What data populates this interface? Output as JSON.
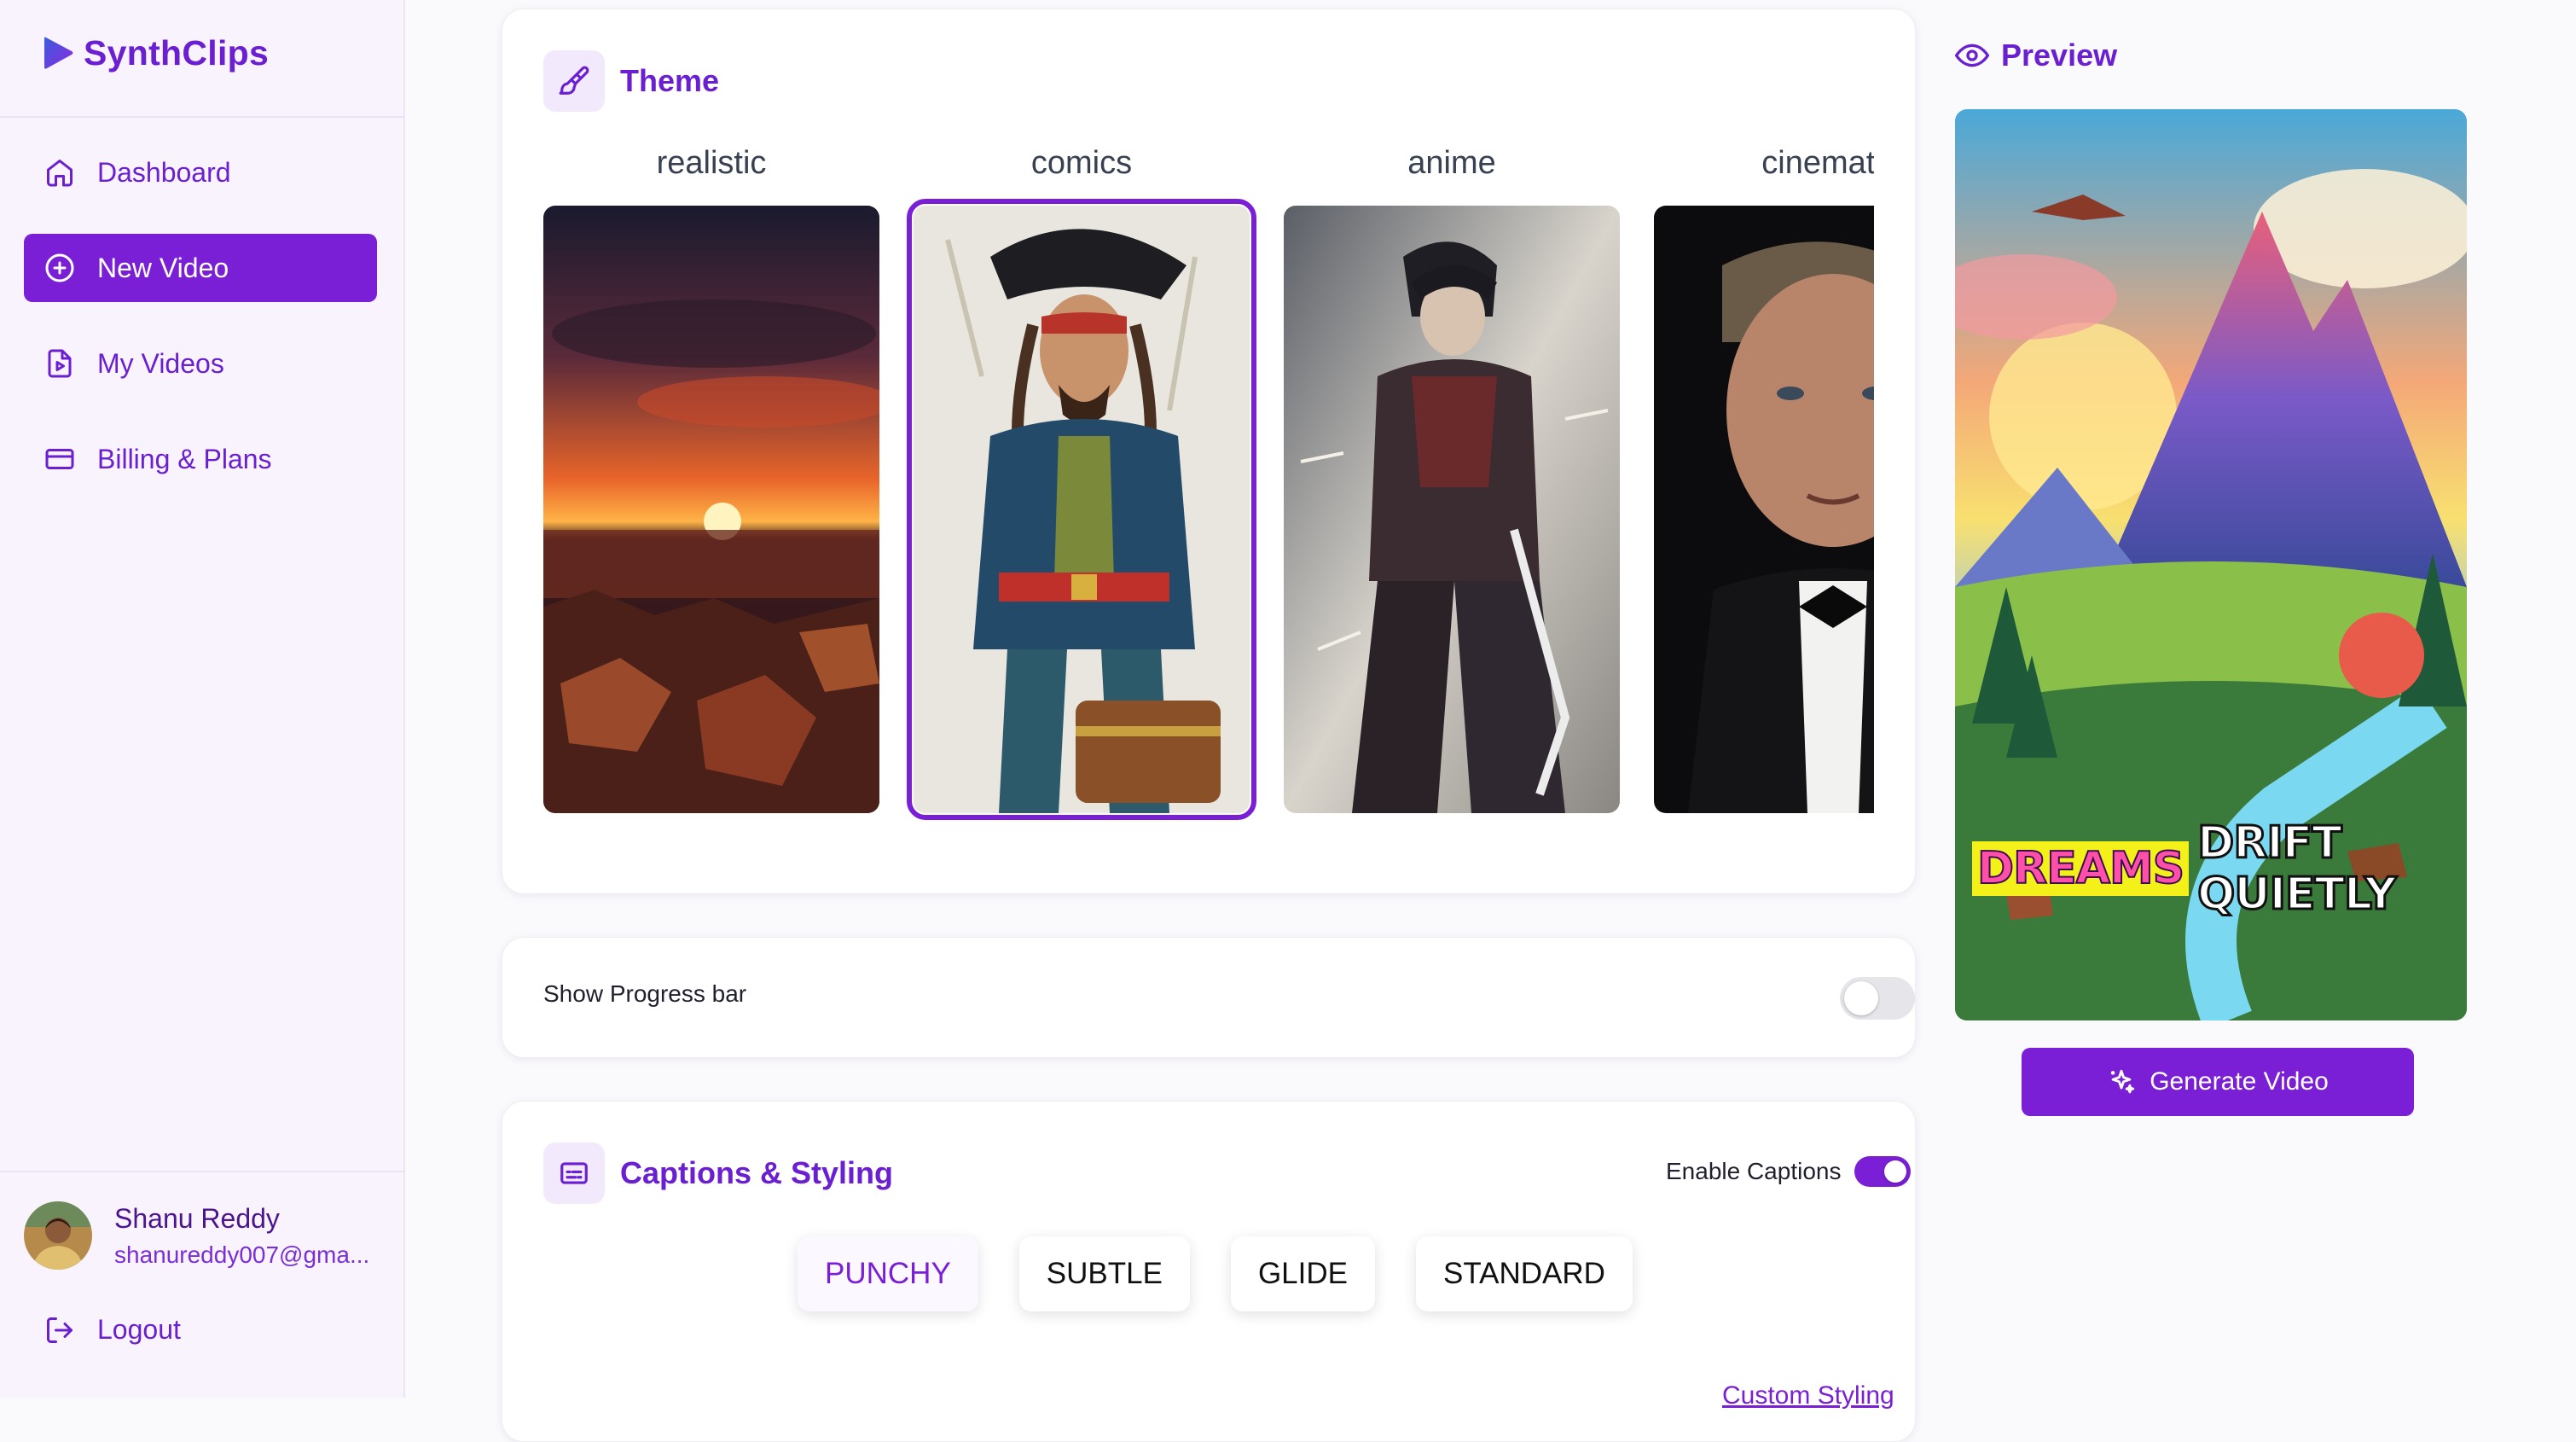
{
  "brand": {
    "name": "SynthClips"
  },
  "sidebar": {
    "items": [
      {
        "label": "Dashboard",
        "icon": "home-icon",
        "active": false
      },
      {
        "label": "New Video",
        "icon": "plus-circle-icon",
        "active": true
      },
      {
        "label": "My Videos",
        "icon": "file-video-icon",
        "active": false
      },
      {
        "label": "Billing & Plans",
        "icon": "credit-card-icon",
        "active": false
      }
    ],
    "user": {
      "name": "Shanu Reddy",
      "email": "shanureddy007@gma..."
    },
    "logout_label": "Logout"
  },
  "theme_section": {
    "title": "Theme",
    "icon": "paintbrush-icon",
    "themes": [
      {
        "label": "realistic",
        "selected": false
      },
      {
        "label": "comics",
        "selected": true
      },
      {
        "label": "anime",
        "selected": false
      },
      {
        "label": "cinemati",
        "selected": false
      }
    ]
  },
  "progress_section": {
    "label": "Show Progress bar",
    "enabled": false
  },
  "captions_section": {
    "title": "Captions & Styling",
    "icon": "captions-icon",
    "enable_label": "Enable Captions",
    "enabled": true,
    "styles": [
      "PUNCHY",
      "SUBTLE",
      "GLIDE",
      "STANDARD"
    ],
    "active_style": "PUNCHY",
    "custom_link": "Custom Styling"
  },
  "preview": {
    "title": "Preview",
    "icon": "eye-icon",
    "caption_highlight": "DREAMS",
    "caption_rest": "DRIFT QUIETLY",
    "generate_label": "Generate Video",
    "generate_icon": "sparkles-icon"
  },
  "colors": {
    "accent": "#7a1fd6",
    "brand": "#6a1fd1",
    "sidebar_bg": "#f8f3fd"
  }
}
